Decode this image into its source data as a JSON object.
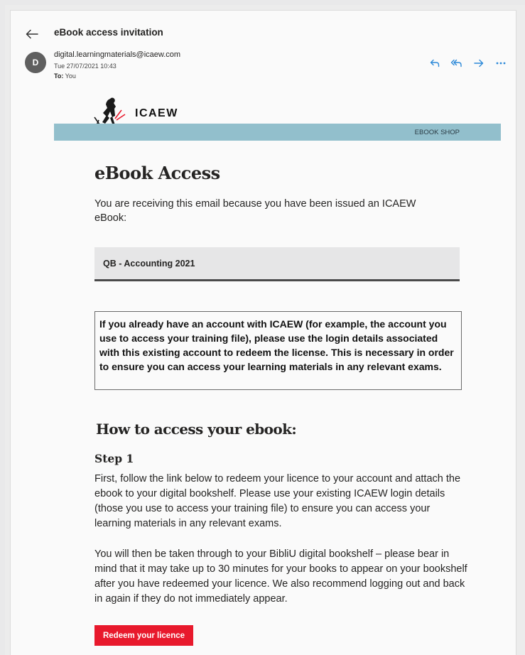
{
  "header": {
    "subject": "eBook access invitation",
    "avatar_initial": "D",
    "sender": "digital.learningmaterials@icaew.com",
    "date": "Tue 27/07/2021 10:43",
    "to_label": "To:",
    "to_value": "You",
    "actions": [
      "reply-icon",
      "reply-all-icon",
      "forward-icon",
      "more-icon"
    ],
    "accent_color": "#2b88d8"
  },
  "email": {
    "logo_text": "ICAEW",
    "banner_link": "EBOOK SHOP",
    "banner_color": "#92bfcc",
    "heading": "eBook Access",
    "intro": "You are receiving this email because you have been issued an ICAEW eBook:",
    "product": "QB - Accounting 2021",
    "notice": "If you already have an account with ICAEW (for example, the account you use to access your training file), please use the login details associated with this existing account to redeem the license. This is necessary in order to ensure you can access your learning materials in any relevant exams.",
    "how_heading": "How to access your ebook:",
    "step1_heading": "Step 1",
    "step1_para1": "First, follow the link below to redeem your licence to your account and attach the ebook to your digital bookshelf. Please use your existing ICAEW login details (those you use to access your training file) to ensure you can access your learning materials in any relevant exams.",
    "step1_para2": "You will then be taken through to your BibliU digital bookshelf – please bear in mind that it may take up to 30 minutes for your books to appear on your bookshelf after you have redeemed your licence. We also recommend logging out and back in again if they do not immediately appear.",
    "redeem_label": "Redeem your licence",
    "redeem_color": "#e8192c"
  }
}
